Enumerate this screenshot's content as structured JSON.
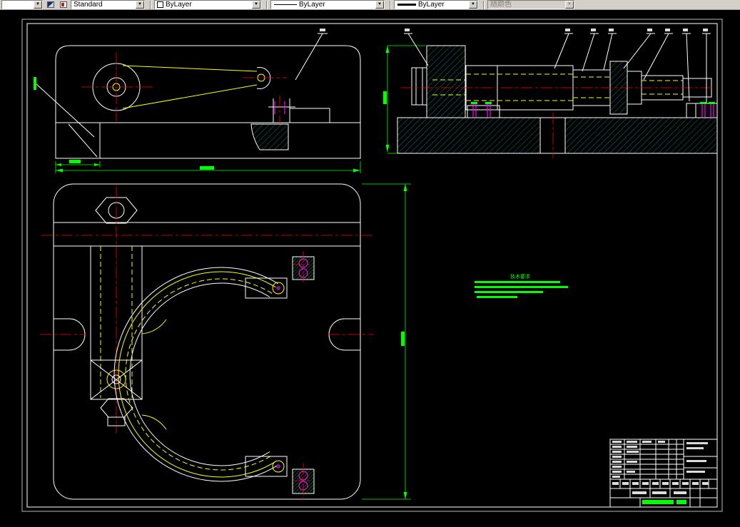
{
  "toolbar": {
    "style_combo_value": "Standard",
    "color_combo_value": "ByLayer",
    "linetype_combo_value": "ByLayer",
    "lineweight_combo_value": "ByLayer",
    "plotstyle_combo_value": "随颜色"
  },
  "icons": {
    "dropdown_arrow": "▼"
  },
  "drawing": {
    "tech_requirements_title": "技术要求"
  },
  "colors": {
    "toolbar_bg": "#d4d0c8",
    "canvas_bg": "#000000",
    "outline": "#ffffff",
    "hidden_line": "#ffff00",
    "centerline": "#ff0000",
    "dimension": "#00ff00",
    "hatch": "#0d8989",
    "detail": "#ff00ff",
    "annotation": "#00ff00"
  }
}
